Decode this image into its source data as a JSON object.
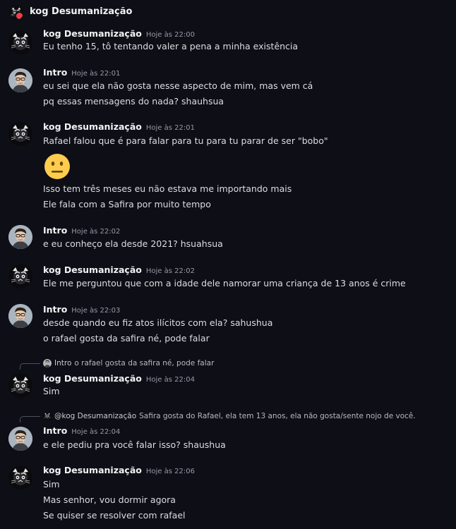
{
  "header": {
    "title": "kog Desumanização"
  },
  "users": {
    "kog": "kog Desumanização",
    "intro": "Intro"
  },
  "messages": [
    {
      "author": "kog Desumanização",
      "time": "Hoje às 22:00",
      "lines": [
        "Eu tenho 15, tô tentando valer a pena a minha existência"
      ]
    },
    {
      "author": "Intro",
      "time": "Hoje às 22:01",
      "lines": [
        "eu sei que ela não gosta nesse aspecto de mim, mas vem cá",
        "pq essas mensagens do nada? shauhsua"
      ]
    },
    {
      "author": "kog Desumanização",
      "time": "Hoje às 22:01",
      "lines": [
        "Rafael falou que é para falar para tu para tu parar de ser \"bobo\"",
        "Isso tem três meses eu não estava me importando mais",
        "Ele fala com a Safira por muito tempo"
      ],
      "emoji": "neutral-face"
    },
    {
      "author": "Intro",
      "time": "Hoje às 22:02",
      "lines": [
        "e eu conheço ela desde 2021? hsuahsua"
      ]
    },
    {
      "author": "kog Desumanização",
      "time": "Hoje às 22:02",
      "lines": [
        "Ele me perguntou que com a idade dele namorar uma criança de 13 anos é crime"
      ]
    },
    {
      "author": "Intro",
      "time": "Hoje às 22:03",
      "lines": [
        "desde quando eu fiz atos ilícitos com ela? sahushua",
        "o rafael gosta da safira né, pode falar"
      ]
    },
    {
      "author": "kog Desumanização",
      "time": "Hoje às 22:04",
      "lines": [
        "Sim"
      ],
      "reply": {
        "name": "Intro",
        "text": "o rafael gosta da safira né, pode falar"
      }
    },
    {
      "author": "Intro",
      "time": "Hoje às 22:04",
      "lines": [
        "e ele pediu pra você falar isso? shaushua"
      ],
      "reply": {
        "name": "@kog Desumanização",
        "text": "Safira gosta do Rafael, ela tem 13 anos, ela não gosta/sente nojo de você."
      }
    },
    {
      "author": "kog Desumanização",
      "time": "Hoje às 22:06",
      "lines": [
        "Sim",
        "Mas senhor, vou dormir agora",
        "Se quiser se resolver com rafael"
      ]
    }
  ]
}
